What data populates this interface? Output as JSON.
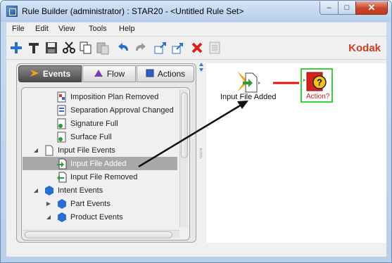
{
  "window": {
    "title": "Rule Builder (administrator) : STAR20 - <Untitled Rule Set>",
    "controls": {
      "minimize": "–",
      "maximize": "□",
      "close": "✕"
    }
  },
  "menu": [
    "File",
    "Edit",
    "View",
    "Tools",
    "Help"
  ],
  "toolbar": {
    "icons": [
      "new-icon",
      "properties-icon",
      "save-icon",
      "cut-icon",
      "copy-icon",
      "paste-icon",
      "undo-icon",
      "redo-icon",
      "import-icon",
      "export-icon",
      "delete-icon",
      "notes-icon"
    ],
    "brand": "Kodak"
  },
  "tabs": [
    {
      "label": "Events",
      "active": true
    },
    {
      "label": "Flow",
      "active": false
    },
    {
      "label": "Actions",
      "active": false
    }
  ],
  "tree": [
    {
      "label": "Imposition Plan Removed",
      "level": 2,
      "icon": "imposition-removed-icon"
    },
    {
      "label": "Separation Approval Changed",
      "level": 2,
      "icon": "separation-icon"
    },
    {
      "label": "Signature Full",
      "level": 2,
      "icon": "signature-icon"
    },
    {
      "label": "Surface Full",
      "level": 2,
      "icon": "surface-icon"
    },
    {
      "label": "Input File Events",
      "level": 1,
      "icon": "document-icon",
      "expanded": true
    },
    {
      "label": "Input File Added",
      "level": 2,
      "icon": "file-added-icon",
      "selected": true
    },
    {
      "label": "Input File Removed",
      "level": 2,
      "icon": "file-removed-icon"
    },
    {
      "label": "Intent Events",
      "level": 1,
      "icon": "hexagon-icon",
      "expanded": true
    },
    {
      "label": "Part Events",
      "level": 2,
      "icon": "hexagon-icon",
      "expanded": false
    },
    {
      "label": "Product Events",
      "level": 2,
      "icon": "hexagon-icon",
      "expanded": true
    }
  ],
  "canvas": {
    "event_node": {
      "label": "Input File Added",
      "icon": "file-added-event-icon"
    },
    "action_node": {
      "label": "Action?",
      "icon": "question-icon"
    }
  },
  "colors": {
    "accent": "#d13a23",
    "selection": "#a9a9a9",
    "action_border": "#39d339",
    "link": "#e01010"
  }
}
